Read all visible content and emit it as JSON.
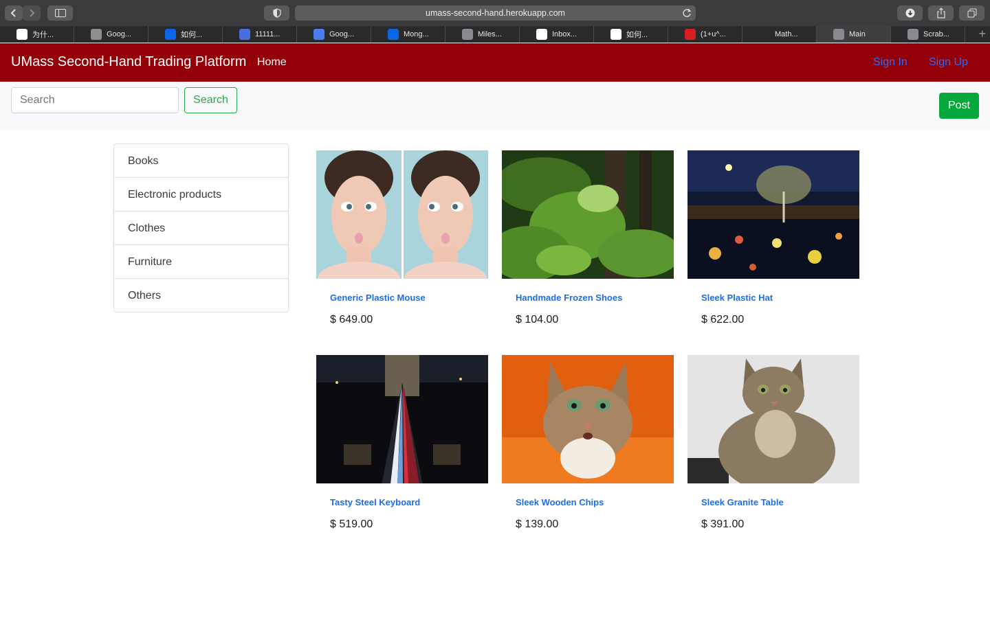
{
  "browser": {
    "url": "umass-second-hand.herokuapp.com",
    "tabs": [
      {
        "label": "为什...",
        "favicon": "google-icon",
        "color": "#ffffff"
      },
      {
        "label": "Goog...",
        "favicon": "google-docs-icon",
        "color": "#8e8e8e"
      },
      {
        "label": "如何...",
        "favicon": "zhihu-icon",
        "color": "#0a66e4"
      },
      {
        "label": "11111...",
        "favicon": "document-icon",
        "color": "#4a6ee0"
      },
      {
        "label": "Goog...",
        "favicon": "google-translate-icon",
        "color": "#4a7cf0"
      },
      {
        "label": "Mong...",
        "favicon": "zhihu-icon",
        "color": "#0a66e4"
      },
      {
        "label": "Miles...",
        "favicon": "letter-g-icon",
        "color": "#8a8a8e"
      },
      {
        "label": "Inbox...",
        "favicon": "gmail-icon",
        "color": "#ffffff"
      },
      {
        "label": "如何...",
        "favicon": "google-icon",
        "color": "#ffffff"
      },
      {
        "label": "(1+u^...",
        "favicon": "symbolab-icon",
        "color": "#d81e1e"
      },
      {
        "label": "Math...",
        "favicon": "chart-bars-icon",
        "color": "#2a2a2c"
      },
      {
        "label": "Main",
        "favicon": "letter-u-icon",
        "color": "#8a8a8e"
      },
      {
        "label": "Scrab...",
        "favicon": "letter-s-icon",
        "color": "#8a8a8e"
      }
    ]
  },
  "navbar": {
    "brand": "UMass Second-Hand Trading Platform",
    "home": "Home",
    "sign_in": "Sign In",
    "sign_up": "Sign Up",
    "color": "#930007"
  },
  "search": {
    "placeholder": "Search",
    "button": "Search",
    "post_button": "Post"
  },
  "categories": [
    "Books",
    "Electronic products",
    "Clothes",
    "Furniture",
    "Others"
  ],
  "products": [
    {
      "title": "Generic Plastic Mouse",
      "price": "$ 649.00",
      "image": "twin-face-photo"
    },
    {
      "title": "Handmade Frozen Shoes",
      "price": "$ 104.00",
      "image": "forest-photo"
    },
    {
      "title": "Sleek Plastic Hat",
      "price": "$ 622.00",
      "image": "night-lights-photo"
    },
    {
      "title": "Tasty Steel Keyboard",
      "price": "$ 519.00",
      "image": "bridge-night-photo"
    },
    {
      "title": "Sleek Wooden Chips",
      "price": "$ 139.00",
      "image": "cat-orange-photo"
    },
    {
      "title": "Sleek Granite Table",
      "price": "$ 391.00",
      "image": "cat-sitting-photo"
    }
  ]
}
